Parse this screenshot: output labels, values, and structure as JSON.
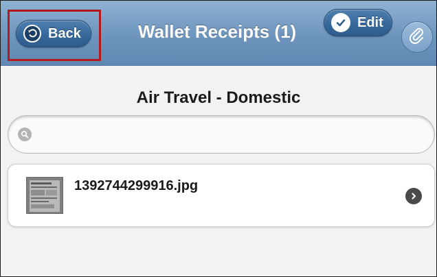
{
  "header": {
    "title": "Wallet Receipts (1)",
    "back_label": "Back",
    "edit_label": "Edit"
  },
  "category": {
    "title": "Air Travel - Domestic"
  },
  "search": {
    "value": "",
    "placeholder": ""
  },
  "receipts": [
    {
      "filename": "1392744299916.jpg"
    }
  ],
  "icons": {
    "back": "back-arrow-icon",
    "edit": "checkmark-icon",
    "attach": "paperclip-icon",
    "search": "search-icon",
    "row": "chevron-right-icon"
  },
  "colors": {
    "header_bg": "#6e95bd",
    "button_bg": "#35679a",
    "highlight": "#b3191d",
    "page_bg": "#f2f2f2"
  }
}
